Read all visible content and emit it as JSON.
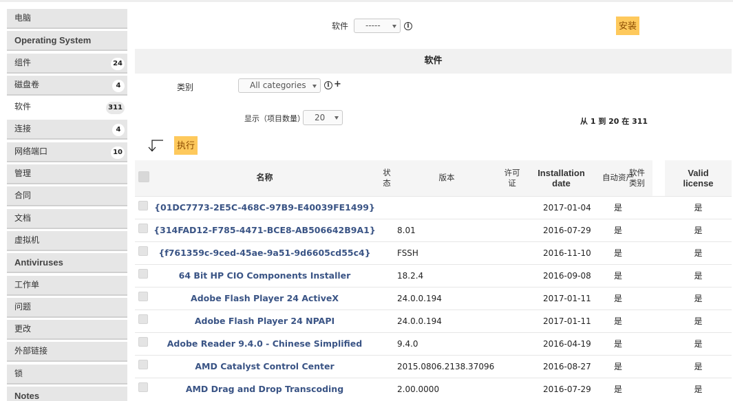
{
  "sidebar": {
    "items": [
      {
        "label": "电脑",
        "badge": "",
        "bold": false,
        "active": false
      },
      {
        "label": "Operating System",
        "badge": "",
        "bold": true,
        "active": false
      },
      {
        "label": "组件",
        "badge": "24",
        "bold": false,
        "active": false
      },
      {
        "label": "磁盘卷",
        "badge": "4",
        "bold": false,
        "active": false
      },
      {
        "label": "软件",
        "badge": "311",
        "bold": false,
        "active": true
      },
      {
        "label": "连接",
        "badge": "4",
        "bold": false,
        "active": false
      },
      {
        "label": "网络端口",
        "badge": "10",
        "bold": false,
        "active": false
      },
      {
        "label": "管理",
        "badge": "",
        "bold": false,
        "active": false
      },
      {
        "label": "合同",
        "badge": "",
        "bold": false,
        "active": false
      },
      {
        "label": "文档",
        "badge": "",
        "bold": false,
        "active": false
      },
      {
        "label": "虚拟机",
        "badge": "",
        "bold": false,
        "active": false
      },
      {
        "label": "Antiviruses",
        "badge": "",
        "bold": true,
        "active": false
      },
      {
        "label": "工作单",
        "badge": "",
        "bold": false,
        "active": false
      },
      {
        "label": "问题",
        "badge": "",
        "bold": false,
        "active": false
      },
      {
        "label": "更改",
        "badge": "",
        "bold": false,
        "active": false
      },
      {
        "label": "外部链接",
        "badge": "",
        "bold": false,
        "active": false
      },
      {
        "label": "锁",
        "badge": "",
        "bold": false,
        "active": false
      },
      {
        "label": "Notes",
        "badge": "",
        "bold": true,
        "active": false
      }
    ]
  },
  "install_form": {
    "label": "软件",
    "select_value": "-----",
    "info_glyph": "i",
    "install_button": "安装"
  },
  "section_title": "软件",
  "filter": {
    "category_label": "类别",
    "category_value": "All categories",
    "plus_glyph": "+",
    "display_label": "显示（项目数量）",
    "display_value": "20",
    "pagination": "从 1 到 20 在 311"
  },
  "actions": {
    "execute_button": "执行"
  },
  "table": {
    "headers": {
      "name": "名称",
      "status": "状态",
      "version": "版本",
      "license": "许可证",
      "install_date": "Installation date",
      "auto_asset": "自动资产",
      "software_category": "软件类别",
      "valid_license": "Valid license"
    },
    "rows": [
      {
        "name": "{01DC7773-2E5C-468C-97B9-E40039FE1499}",
        "status": "",
        "version": "",
        "license": "",
        "date": "2017-01-04",
        "auto": "是",
        "category": "",
        "valid": "是"
      },
      {
        "name": "{314FAD12-F785-4471-BCE8-AB506642B9A1}",
        "status": "",
        "version": "8.01",
        "license": "",
        "date": "2016-07-29",
        "auto": "是",
        "category": "",
        "valid": "是"
      },
      {
        "name": "{f761359c-9ced-45ae-9a51-9d6605cd55c4}",
        "status": "",
        "version": "FSSH",
        "license": "",
        "date": "2016-11-10",
        "auto": "是",
        "category": "",
        "valid": "是"
      },
      {
        "name": "64 Bit HP CIO Components Installer",
        "status": "",
        "version": "18.2.4",
        "license": "",
        "date": "2016-09-08",
        "auto": "是",
        "category": "",
        "valid": "是"
      },
      {
        "name": "Adobe Flash Player 24 ActiveX",
        "status": "",
        "version": "24.0.0.194",
        "license": "",
        "date": "2017-01-11",
        "auto": "是",
        "category": "",
        "valid": "是"
      },
      {
        "name": "Adobe Flash Player 24 NPAPI",
        "status": "",
        "version": "24.0.0.194",
        "license": "",
        "date": "2017-01-11",
        "auto": "是",
        "category": "",
        "valid": "是"
      },
      {
        "name": "Adobe Reader 9.4.0 - Chinese Simplified",
        "status": "",
        "version": "9.4.0",
        "license": "",
        "date": "2016-04-19",
        "auto": "是",
        "category": "",
        "valid": "是"
      },
      {
        "name": "AMD Catalyst Control Center",
        "status": "",
        "version": "2015.0806.2138.37096",
        "license": "",
        "date": "2016-08-27",
        "auto": "是",
        "category": "",
        "valid": "是"
      },
      {
        "name": "AMD Drag and Drop Transcoding",
        "status": "",
        "version": "2.00.0000",
        "license": "",
        "date": "2016-07-29",
        "auto": "是",
        "category": "",
        "valid": "是"
      }
    ]
  },
  "colors": {
    "accent_button": "#fec95c",
    "link": "#3a5485",
    "sidebar_bg": "#e6e6e6"
  }
}
